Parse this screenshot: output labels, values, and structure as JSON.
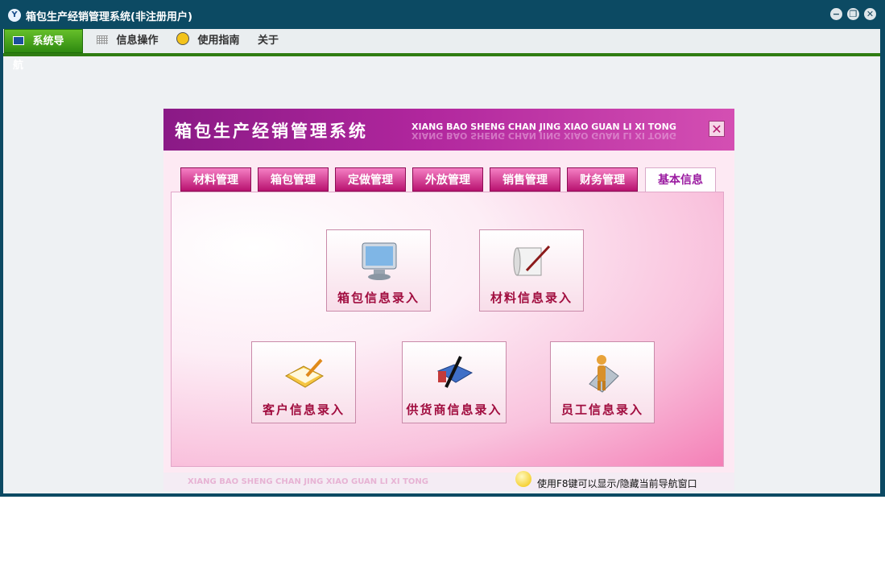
{
  "window": {
    "title": "箱包生产经销管理系统(非注册用户)",
    "app_icon": "Y",
    "controls": {
      "minimize": "−",
      "restore": "❐",
      "close": "✕"
    }
  },
  "menubar": {
    "items": [
      {
        "label": "系统导航",
        "icon": "monitor-icon",
        "active": true
      },
      {
        "label": "信息操作",
        "icon": "grid-icon",
        "active": false
      },
      {
        "label": "使用指南",
        "icon": "help-icon",
        "active": false
      },
      {
        "label": "关于",
        "icon": "",
        "active": false
      }
    ]
  },
  "panel": {
    "title": "箱包生产经销管理系统",
    "subtitle": "XIANG BAO SHENG CHAN JING XIAO GUAN LI XI TONG",
    "close_glyph": "✕",
    "tabs": [
      {
        "label": "材料管理"
      },
      {
        "label": "箱包管理"
      },
      {
        "label": "定做管理"
      },
      {
        "label": "外放管理"
      },
      {
        "label": "销售管理"
      },
      {
        "label": "财务管理"
      },
      {
        "label": "基本信息",
        "active": true
      }
    ],
    "buttons": [
      {
        "label": "箱包信息录入",
        "icon": "monitor-icon"
      },
      {
        "label": "材料信息录入",
        "icon": "scroll-pen-icon"
      },
      {
        "label": "客户信息录入",
        "icon": "notebook-pencil-icon"
      },
      {
        "label": "供货商信息录入",
        "icon": "book-pen-icon"
      },
      {
        "label": "员工信息录入",
        "icon": "person-icon"
      }
    ],
    "footer": {
      "brand": "XIANG BAO SHENG CHAN JING XIAO GUAN LI XI TONG",
      "hint": "使用F8键可以显示/隐藏当前导航窗口"
    }
  },
  "colors": {
    "window_frame": "#0c4a63",
    "menu_active": "#3a9a17",
    "banner": "#a3208f",
    "tab": "#d02a8a",
    "button_text": "#a10d3f"
  }
}
